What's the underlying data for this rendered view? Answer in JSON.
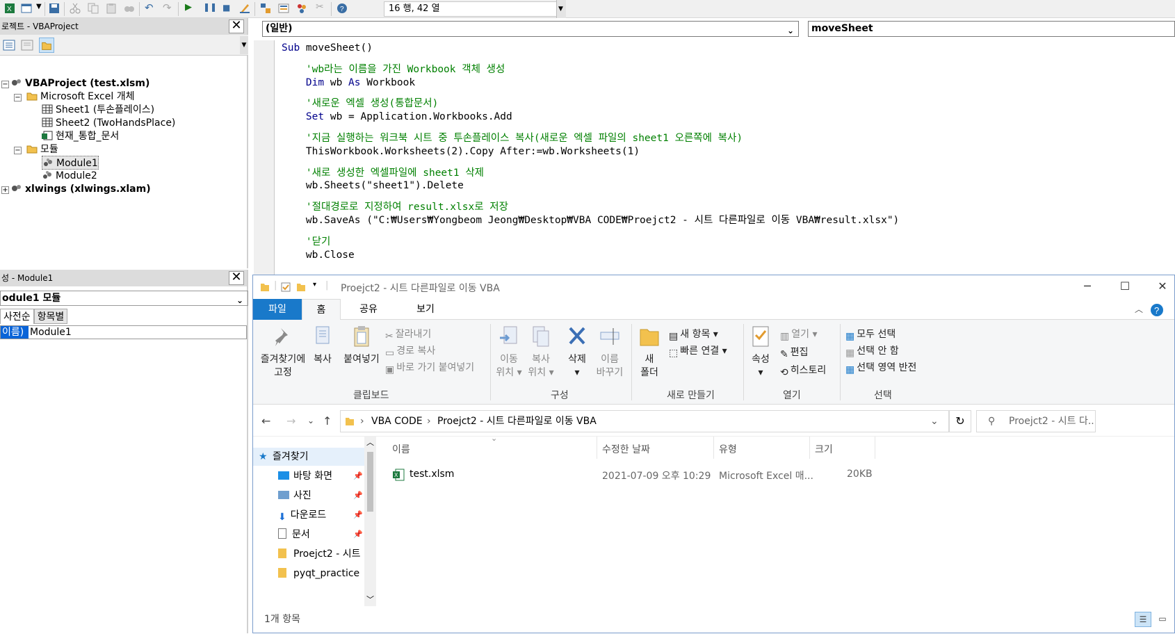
{
  "toolbar": {
    "cursor_position": "16 행, 42 열",
    "icons": [
      "excel-icon",
      "insert-userform-icon",
      "dropdown-icon",
      "save-icon",
      "cut-icon",
      "copy-icon",
      "paste-icon",
      "find-icon",
      "undo-icon",
      "redo-icon",
      "run-icon",
      "break-icon",
      "reset-icon",
      "design-mode-icon",
      "project-explorer-icon",
      "properties-icon",
      "object-browser-icon",
      "toolbox-icon",
      "help-icon"
    ]
  },
  "project_pane": {
    "title": "로젝트 - VBAProject",
    "tree": [
      {
        "label": "VBAProject (test.xlsm)",
        "icon": "vba-project-icon"
      },
      {
        "label": "Microsoft Excel 개체",
        "icon": "folder-icon"
      },
      {
        "label": "Sheet1 (투손플레이스)",
        "icon": "sheet-icon"
      },
      {
        "label": "Sheet2 (TwoHandsPlace)",
        "icon": "sheet-icon"
      },
      {
        "label": "현재_통합_문서",
        "icon": "workbook-icon"
      },
      {
        "label": "모듈",
        "icon": "folder-icon"
      },
      {
        "label": "Module1",
        "icon": "module-icon"
      },
      {
        "label": "Module2",
        "icon": "module-icon"
      },
      {
        "label": "xlwings (xlwings.xlam)",
        "icon": "vba-project-icon"
      }
    ]
  },
  "props_pane": {
    "title": "성 - Module1",
    "selected": "odule1 모듈",
    "tab_alpha": "사전순",
    "tab_category": "항목별",
    "row_name": "이름)",
    "row_value": "Module1"
  },
  "code_window": {
    "object_combo": "(일반)",
    "proc_combo": "moveSheet",
    "lines": [
      {
        "parts": [
          {
            "t": "Sub",
            "c": "kw"
          },
          {
            "t": " moveSheet()",
            "c": ""
          }
        ]
      },
      {
        "parts": [
          {
            "t": "",
            "c": ""
          }
        ]
      },
      {
        "parts": [
          {
            "t": "    'wb라는 이름을 가진 Workbook 객체 생성",
            "c": "cm"
          }
        ]
      },
      {
        "parts": [
          {
            "t": "    ",
            "c": ""
          },
          {
            "t": "Dim",
            "c": "kw"
          },
          {
            "t": " wb ",
            "c": ""
          },
          {
            "t": "As",
            "c": "kw"
          },
          {
            "t": " Workbook",
            "c": ""
          }
        ]
      },
      {
        "parts": [
          {
            "t": "",
            "c": ""
          }
        ]
      },
      {
        "parts": [
          {
            "t": "    '새로운 엑셀 생성(통합문서)",
            "c": "cm"
          }
        ]
      },
      {
        "parts": [
          {
            "t": "    ",
            "c": ""
          },
          {
            "t": "Set",
            "c": "kw"
          },
          {
            "t": " wb = Application.Workbooks.Add",
            "c": ""
          }
        ]
      },
      {
        "parts": [
          {
            "t": "",
            "c": ""
          }
        ]
      },
      {
        "parts": [
          {
            "t": "    '지금 실행하는 워크북 시트 중 투손플레이스 복사(새로운 엑셀 파일의 sheet1 오른쪽에 복사)",
            "c": "cm"
          }
        ]
      },
      {
        "parts": [
          {
            "t": "    ThisWorkbook.Worksheets(2).Copy After:=wb.Worksheets(1)",
            "c": ""
          }
        ]
      },
      {
        "parts": [
          {
            "t": "",
            "c": ""
          }
        ]
      },
      {
        "parts": [
          {
            "t": "    '새로 생성한 엑셀파일에 sheet1 삭제",
            "c": "cm"
          }
        ]
      },
      {
        "parts": [
          {
            "t": "    wb.Sheets(\"sheet1\").Delete",
            "c": ""
          }
        ]
      },
      {
        "parts": [
          {
            "t": "",
            "c": ""
          }
        ]
      },
      {
        "parts": [
          {
            "t": "    '절대경로로 지정하여 result.xlsx로 저장",
            "c": "cm"
          }
        ]
      },
      {
        "parts": [
          {
            "t": "    wb.SaveAs (\"C:₩Users₩Yongbeom Jeong₩Desktop₩VBA CODE₩Proejct2 - 시트 다른파일로 이동 VBA₩result.xlsx\")",
            "c": ""
          }
        ]
      },
      {
        "parts": [
          {
            "t": "",
            "c": ""
          }
        ]
      },
      {
        "parts": [
          {
            "t": "    '닫기",
            "c": "cm"
          }
        ]
      },
      {
        "parts": [
          {
            "t": "    wb.Close",
            "c": ""
          }
        ]
      }
    ]
  },
  "explorer": {
    "title": "Proejct2 - 시트 다른파일로 이동 VBA",
    "tabs": {
      "file": "파일",
      "home": "홈",
      "share": "공유",
      "view": "보기"
    },
    "ribbon": {
      "pin_quick": "즐겨찾기에\n고정",
      "copy": "복사",
      "paste": "붙여넣기",
      "cut": "잘라내기",
      "copy_path": "경로 복사",
      "paste_shortcut": "바로 가기 붙여넣기",
      "group_clipboard": "클립보드",
      "move_to": "이동\n위치 ▾",
      "copy_to": "복사\n위치 ▾",
      "delete": "삭제\n▾",
      "rename": "이름\n바꾸기",
      "group_organize": "구성",
      "new_folder": "새\n폴더",
      "new_item": "새 항목 ▾",
      "easy_access": "빠른 연결 ▾",
      "group_new": "새로 만들기",
      "properties": "속성\n▾",
      "open": "열기 ▾",
      "edit": "편집",
      "history": "히스토리",
      "group_open": "열기",
      "select_all": "모두 선택",
      "select_none": "선택 안 함",
      "invert_selection": "선택 영역 반전",
      "group_select": "선택"
    },
    "address": {
      "crumb1": "VBA CODE",
      "crumb2": "Proejct2 - 시트 다른파일로 이동 VBA",
      "search_placeholder": "Proejct2 - 시트 다..."
    },
    "nav": {
      "favorites": "즐겨찾기",
      "items": [
        {
          "label": "바탕 화면",
          "pinned": true
        },
        {
          "label": "사진",
          "pinned": true
        },
        {
          "label": "다운로드",
          "pinned": true
        },
        {
          "label": "문서",
          "pinned": true
        },
        {
          "label": "Proejct2 - 시트 I",
          "pinned": false
        },
        {
          "label": "pyqt_practice",
          "pinned": false
        }
      ]
    },
    "columns": {
      "name": "이름",
      "modified": "수정한 날짜",
      "type": "유형",
      "size": "크기"
    },
    "files": [
      {
        "name": "test.xlsm",
        "modified": "2021-07-09 오후 10:29",
        "type": "Microsoft Excel 매...",
        "size": "20KB"
      }
    ],
    "status": "1개 항목",
    "colors": {
      "accent": "#1979ca",
      "folder": "#f2c14e"
    }
  }
}
